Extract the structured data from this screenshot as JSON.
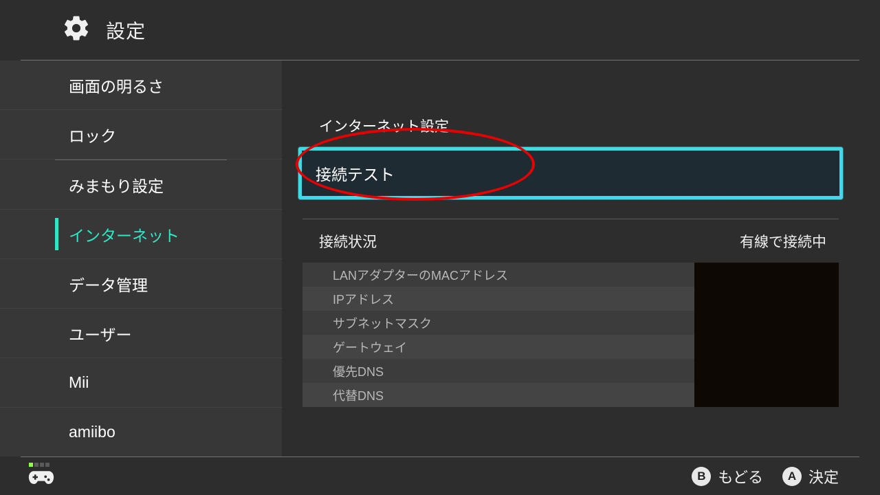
{
  "header": {
    "title": "設定"
  },
  "sidebar": {
    "items": [
      {
        "label": "画面の明るさ",
        "variant": "normal"
      },
      {
        "label": "ロック",
        "variant": "normal"
      },
      {
        "label": "みまもり設定",
        "variant": "after-divider"
      },
      {
        "label": "インターネット",
        "variant": "active"
      },
      {
        "label": "データ管理",
        "variant": "normal"
      },
      {
        "label": "ユーザー",
        "variant": "normal"
      },
      {
        "label": "Mii",
        "variant": "normal"
      },
      {
        "label": "amiibo",
        "variant": "normal"
      }
    ]
  },
  "main": {
    "section_settings_title": "インターネット設定",
    "connection_test_label": "接続テスト",
    "connection_status_label": "接続状況",
    "connection_status_value": "有線で接続中",
    "details": [
      {
        "label": "LANアダプターのMACアドレス"
      },
      {
        "label": "IPアドレス"
      },
      {
        "label": "サブネットマスク"
      },
      {
        "label": "ゲートウェイ"
      },
      {
        "label": "優先DNS"
      },
      {
        "label": "代替DNS"
      }
    ]
  },
  "footer": {
    "back_label": "もどる",
    "back_button": "B",
    "ok_label": "決定",
    "ok_button": "A"
  },
  "colors": {
    "accent": "#2ce8c7",
    "highlight_border": "#3fd9e8",
    "annotation": "#e60000"
  }
}
